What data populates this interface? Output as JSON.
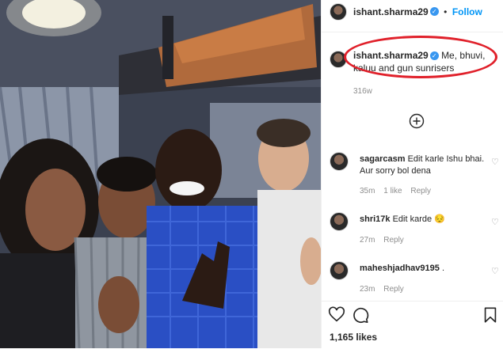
{
  "post": {
    "username": "ishant.sharma29",
    "follow_separator": "•",
    "follow_label": "Follow",
    "caption_username": "ishant.sharma29",
    "caption_text": "Me, bhuvi, kaluu and gun sunrisers",
    "caption_age": "316w",
    "likes": "1,165 likes"
  },
  "comments": [
    {
      "username": "sagarcasm",
      "text": "Edit karle Ishu bhai. Aur sorry bol dena",
      "age": "35m",
      "likes": "1 like",
      "reply": "Reply"
    },
    {
      "username": "shri17k",
      "text": "Edit karde 😔",
      "age": "27m",
      "reply": "Reply"
    },
    {
      "username": "maheshjadhav9195",
      "text": ".",
      "age": "23m",
      "reply": "Reply"
    }
  ],
  "icons": {
    "verified": "verified-badge-icon",
    "load_more": "plus-circle-icon",
    "heart": "heart-icon",
    "comment": "comment-icon",
    "save": "bookmark-icon"
  },
  "colors": {
    "follow": "#0095f6",
    "verified": "#3897f0",
    "annotation": "#e0202a",
    "shirt": "#2a4fc4"
  }
}
